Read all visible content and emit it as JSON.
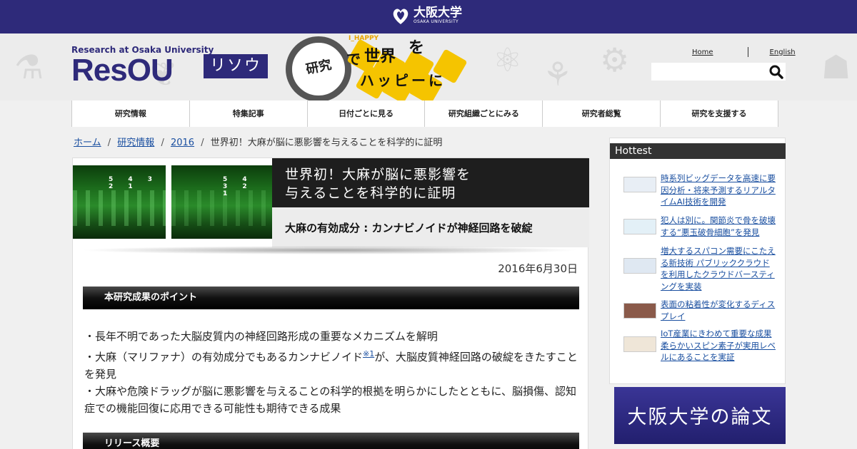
{
  "topbar": {
    "univ_ja": "大阪大学",
    "univ_en": "OSAKA UNIVERSITY"
  },
  "header": {
    "resou_sub": "Research at Osaka University",
    "resou_main": "ResOU",
    "risou": "リソウ",
    "slogan": {
      "i_happy": "I_HAPPY",
      "lab": "研究",
      "de": "で",
      "sekai": "世界",
      "wo": "を",
      "happy": "ハッピーに"
    },
    "links": {
      "home": "Home",
      "english": "English"
    },
    "search_placeholder": ""
  },
  "nav": {
    "items": [
      "研究情報",
      "特集記事",
      "日付ごとに見る",
      "研究組織ごとにみる",
      "研究者総覧",
      "研究を支援する"
    ]
  },
  "breadcrumb": {
    "home": "ホーム",
    "research": "研究情報",
    "year": "2016",
    "current": "世界初！大麻が脳に悪影響を与えることを科学的に証明",
    "separator": "/"
  },
  "article": {
    "image_numbers": "5 4 3 2 1",
    "title_line1": "世界初！大麻が脳に悪影響を",
    "title_line2": "与えることを科学的に証明",
    "subtitle": "大麻の有効成分 : カンナビノイドが神経回路を破綻",
    "date": "2016年6月30日",
    "section1": "本研究成果のポイント",
    "point1": "・長年不明であった大脳皮質内の神経回路形成の重要なメカニズムを解明",
    "point2a": "・大麻（マリファナ）の有効成分でもあるカンナビノイド",
    "point2_ref": "※1",
    "point2b": "が、大脳皮質神経回路の破綻をきたすことを発見",
    "point3": "・大麻や危険ドラッグが脳に悪影響を与えることの科学的根拠を明らかにしたとともに、脳損傷、認知症での機能回復に応用できる可能性も期待できる成果",
    "section2": "リリース概要"
  },
  "sidebar": {
    "hottest": "Hottest",
    "items": [
      "時系列ビッグデータを高速に要因分析・将来予測するリアルタイムAI技術を開発",
      "犯人は別に。関節炎で骨を破壊する“悪玉破骨細胞”を発見",
      "増大するスパコン需要にこたえる新技術 パブリッククラウドを利用したクラウドバースティングを実装",
      "表面の粘着性が変化するディスプレイ",
      "IoT産業にきわめて重要な成果柔らかいスピン素子が実用レベルにあることを実証"
    ],
    "banner": "大阪大学の論文"
  },
  "colors": {
    "brand": "#2e2a7a",
    "link": "#1a4fa0",
    "accent_yellow": "#f5c400"
  }
}
